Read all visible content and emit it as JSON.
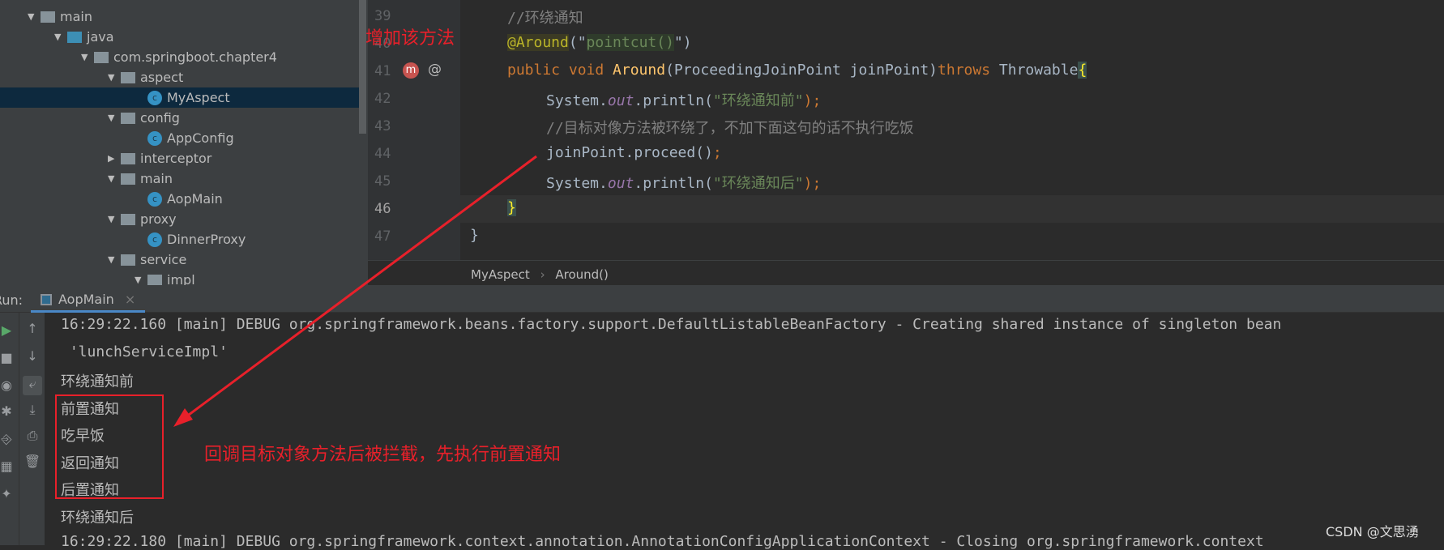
{
  "project_tree": {
    "items": [
      {
        "label": "main",
        "type": "folder",
        "expanded": true,
        "indent": 0
      },
      {
        "label": "java",
        "type": "source-folder",
        "expanded": true,
        "indent": 1
      },
      {
        "label": "com.springboot.chapter4",
        "type": "package",
        "expanded": true,
        "indent": 2
      },
      {
        "label": "aspect",
        "type": "package",
        "expanded": true,
        "indent": 3
      },
      {
        "label": "MyAspect",
        "type": "class",
        "indent": 4,
        "selected": true
      },
      {
        "label": "config",
        "type": "package",
        "expanded": true,
        "indent": 3
      },
      {
        "label": "AppConfig",
        "type": "class",
        "indent": 4
      },
      {
        "label": "interceptor",
        "type": "package",
        "expanded": false,
        "indent": 3
      },
      {
        "label": "main",
        "type": "package",
        "expanded": true,
        "indent": 3
      },
      {
        "label": "AopMain",
        "type": "class",
        "indent": 4
      },
      {
        "label": "proxy",
        "type": "package",
        "expanded": true,
        "indent": 3
      },
      {
        "label": "DinnerProxy",
        "type": "class",
        "indent": 4
      },
      {
        "label": "service",
        "type": "package",
        "expanded": true,
        "indent": 3
      },
      {
        "label": "impl",
        "type": "package",
        "expanded": true,
        "indent": 4
      }
    ]
  },
  "editor": {
    "line_numbers": [
      "39",
      "40",
      "41",
      "42",
      "43",
      "44",
      "45",
      "46",
      "47"
    ],
    "lines": {
      "l39": "//环绕通知",
      "l40_ann": "@Around",
      "l40_p1": "(\"",
      "l40_str": "pointcut()",
      "l40_p2": "\")",
      "l41_kw": "public void ",
      "l41_fn": "Around",
      "l41_params": "(ProceedingJoinPoint joinPoint)",
      "l41_throws": "throws ",
      "l41_type": "Throwable",
      "l41_brace": "{",
      "l42_a": "System.",
      "l42_out": "out",
      "l42_b": ".println(",
      "l42_str": "\"环绕通知前\"",
      "l42_c": ");",
      "l43": "//目标对像方法被环绕了，不加下面这句的话不执行吃饭",
      "l44_a": "joinPoint.proceed()",
      "l44_b": ";",
      "l45_a": "System.",
      "l45_out": "out",
      "l45_b": ".println(",
      "l45_str": "\"环绕通知后\"",
      "l45_c": ");",
      "l46": "}",
      "l47": "}"
    },
    "breadcrumb": [
      "MyAspect",
      "Around()"
    ],
    "breadcrumb_sep": "›"
  },
  "run": {
    "label": "Run:",
    "tab": "AopMain",
    "close": "×"
  },
  "console": {
    "lines": [
      "16:29:22.160 [main] DEBUG org.springframework.beans.factory.support.DefaultListableBeanFactory - Creating shared instance of singleton bean",
      " 'lunchServiceImpl'",
      "环绕通知前",
      "前置通知",
      "吃早饭",
      "返回通知",
      "后置通知",
      "环绕通知后",
      "16:29:22.180 [main] DEBUG org.springframework.context.annotation.AnnotationConfigApplicationContext - Closing org.springframework.context"
    ]
  },
  "annotations": {
    "add_method": "增加该方法",
    "callback_note": "回调目标对象方法后被拦截，先执行前置通知",
    "color": "#e8202a"
  },
  "watermark": "CSDN @文思湧"
}
